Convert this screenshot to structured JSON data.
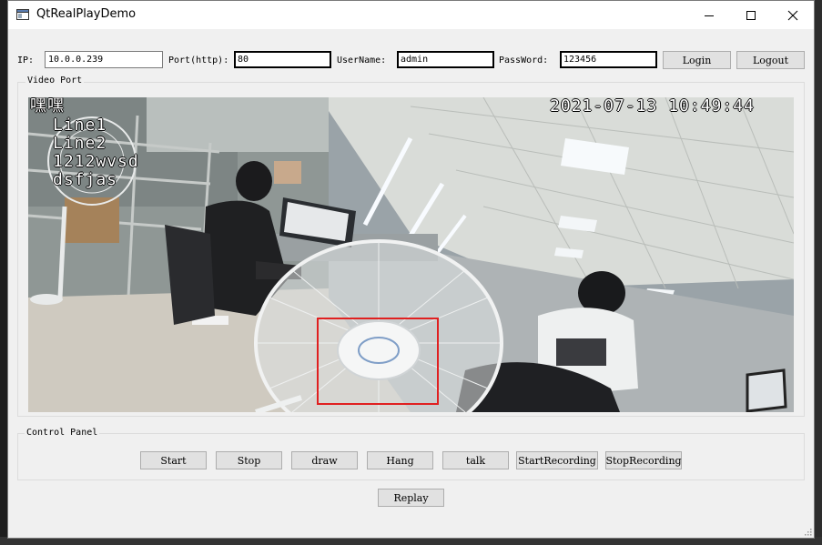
{
  "window": {
    "title": "QtRealPlayDemo"
  },
  "login_bar": {
    "ip_label": "IP:",
    "ip_value": "10.0.0.239",
    "port_label": "Port(http):",
    "port_value": "80",
    "username_label": "UserName:",
    "username_value": "admin",
    "password_label": "PassWord:",
    "password_value": "123456",
    "login_button": "Login",
    "logout_button": "Logout"
  },
  "video_port": {
    "title": "Video Port",
    "osd_lines": [
      "嘿嘿",
      "Line1",
      "Line2",
      "1212wvsd",
      "dsfjas"
    ],
    "timestamp": "2021-07-13 10:49:44",
    "detection_box_color": "#e02020"
  },
  "control_panel": {
    "title": "Control Panel",
    "buttons": [
      "Start",
      "Stop",
      "draw",
      "Hang",
      "talk",
      "StartRecording",
      "StopRecording"
    ]
  },
  "replay_button": "Replay",
  "colors": {
    "window_bg": "#f0f0f0",
    "button_bg": "#e1e1e1",
    "titlebar_bg": "#ffffff"
  }
}
